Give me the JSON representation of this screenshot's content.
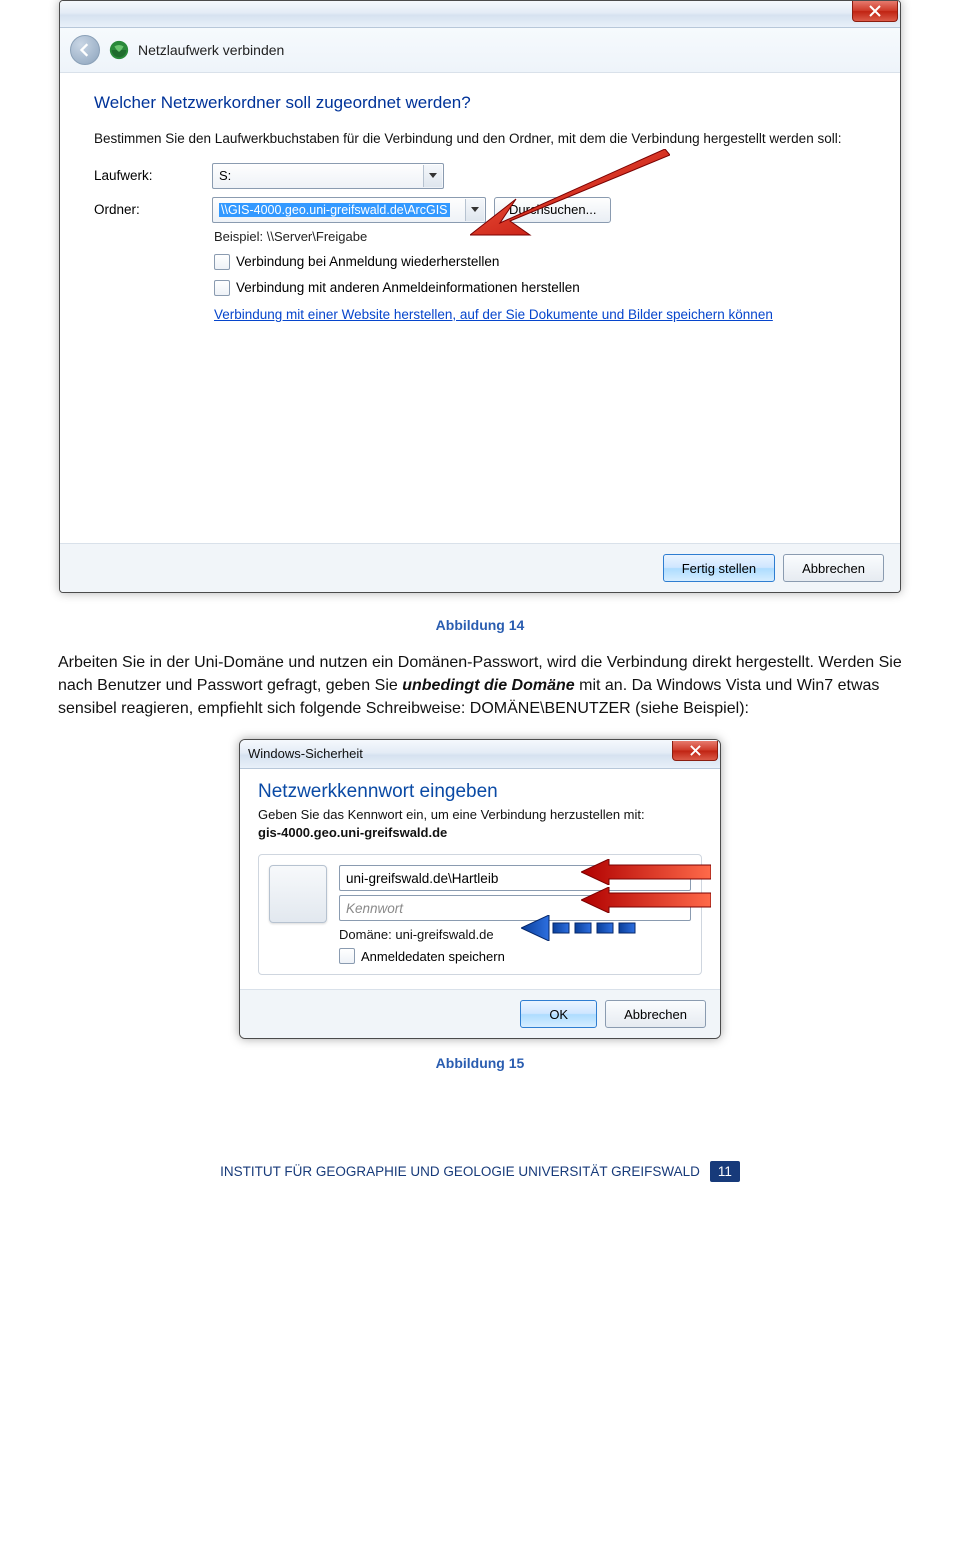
{
  "dialog1": {
    "title_icon": "network-drive-icon",
    "header_text": "Netzlaufwerk verbinden",
    "question_title": "Welcher Netzwerkordner soll zugeordnet werden?",
    "description": "Bestimmen Sie den Laufwerkbuchstaben für die Verbindung und den Ordner, mit dem die Verbindung hergestellt werden soll:",
    "label_drive": "Laufwerk:",
    "drive_value": "S:",
    "label_folder": "Ordner:",
    "folder_value": "\\\\GIS-4000.geo.uni-greifswald.de\\ArcGIS",
    "browse_button": "Durchsuchen...",
    "example_text": "Beispiel: \\\\Server\\Freigabe",
    "reconnect_text": "Verbindung bei Anmeldung wiederherstellen",
    "othercreds_text": "Verbindung mit anderen Anmeldeinformationen herstellen",
    "website_link": "Verbindung mit einer Website herstellen, auf der Sie Dokumente und Bilder speichern können",
    "primary_button": "Fertig stellen",
    "secondary_button": "Abbrechen"
  },
  "caption1": "Abbildung 14",
  "paragraph_part1": "Arbeiten Sie in der Uni-Domäne und nutzen ein Domänen-Passwort, wird die Verbindung direkt hergestellt. Werden Sie nach Benutzer und Passwort gefragt, geben Sie ",
  "paragraph_em": "unbedingt die Domäne",
  "paragraph_part2": " mit an. Da Windows Vista und Win7 etwas sensibel reagieren, empfiehlt sich folgende Schreibweise: DOMÄNE\\BENUTZER (siehe Beispiel):",
  "dialog2": {
    "titlebar": "Windows-Sicherheit",
    "heading": "Netzwerkkennwort eingeben",
    "subtext": "Geben Sie das Kennwort ein, um eine Verbindung herzustellen mit:",
    "host": "gis-4000.geo.uni-greifswald.de",
    "username_value": "uni-greifswald.de\\Hartleib",
    "password_placeholder": "Kennwort",
    "domain_line": "Domäne: uni-greifswald.de",
    "remember_text": "Anmeldedaten speichern",
    "ok_button": "OK",
    "cancel_button": "Abbrechen"
  },
  "caption2": "Abbildung 15",
  "footer_text": "INSTITUT FÜR GEOGRAPHIE UND GEOLOGIE UNIVERSITÄT GREIFSWALD",
  "page_number": "11"
}
